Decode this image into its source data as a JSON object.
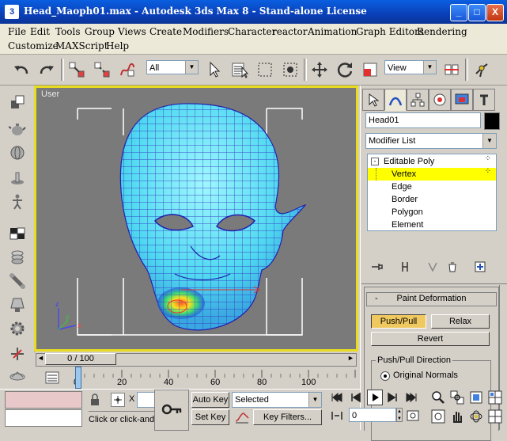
{
  "window": {
    "title": "Head_Maoph01.max - Autodesk 3ds Max 8  - Stand-alone License",
    "app_icon": "3ds-max-icon",
    "minimize": "_",
    "maximize": "□",
    "close": "X"
  },
  "menu": {
    "row1": [
      "File",
      "Edit",
      "Tools",
      "Group",
      "Views",
      "Create",
      "Modifiers",
      "Character",
      "reactor",
      "Animation",
      "Graph Editors",
      "Rendering"
    ],
    "row2": [
      "Customize",
      "MAXScript",
      "Help"
    ]
  },
  "toolbar": {
    "selection_filter": "All",
    "reference_coord": "View"
  },
  "viewport": {
    "label": "User",
    "active_border_color": "#e8dc20",
    "axis_x": "x",
    "axis_y": "y",
    "axis_z": "z"
  },
  "command_panel": {
    "object_name": "Head01",
    "object_color": "#000000",
    "modifier_list": "Modifier List",
    "stack": [
      {
        "label": "Editable Poly",
        "selected": false,
        "level": 0
      },
      {
        "label": "Vertex",
        "selected": true,
        "level": 1
      },
      {
        "label": "Edge",
        "selected": false,
        "level": 1
      },
      {
        "label": "Border",
        "selected": false,
        "level": 1
      },
      {
        "label": "Polygon",
        "selected": false,
        "level": 1
      },
      {
        "label": "Element",
        "selected": false,
        "level": 1
      }
    ],
    "rollout": {
      "title": "Paint Deformation",
      "collapse_sign": "-",
      "push_pull": "Push/Pull",
      "relax": "Relax",
      "revert": "Revert",
      "direction_group": "Push/Pull Direction",
      "original_normals": "Original Normals"
    }
  },
  "timeline": {
    "frame_label": "0 / 100",
    "ticks": [
      "0",
      "20",
      "40",
      "60",
      "80",
      "100"
    ]
  },
  "status": {
    "prompt": "Click or click-and",
    "coord_x_label": "X",
    "auto_key": "Auto Key",
    "set_key": "Set Key",
    "key_mode": "Selected",
    "key_filters": "Key Filters...",
    "current_frame": "0"
  }
}
